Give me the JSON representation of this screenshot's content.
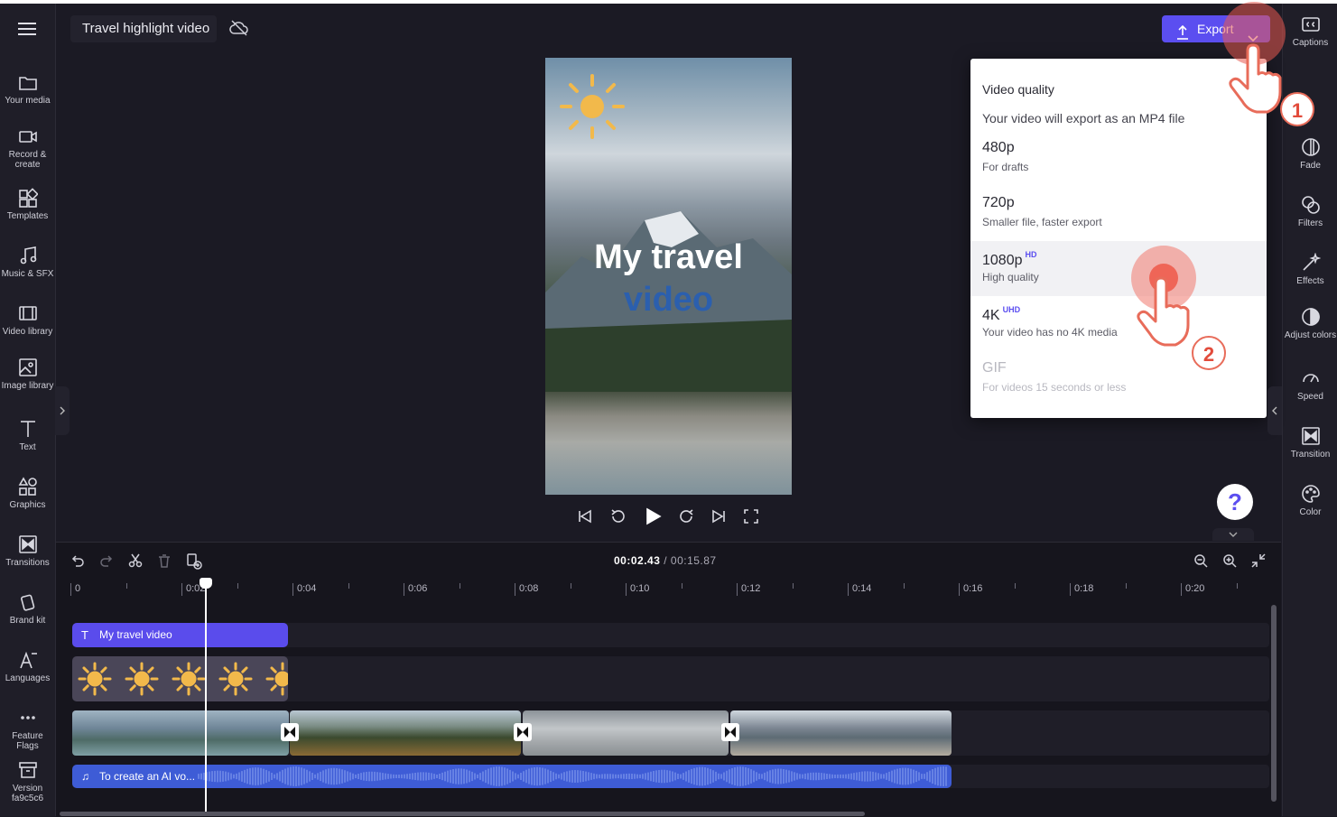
{
  "project": {
    "title": "Travel highlight video"
  },
  "header": {
    "export_label": "Export"
  },
  "left_nav": [
    {
      "label": "Your media",
      "icon": "folder-icon"
    },
    {
      "label": "Record & create",
      "icon": "camera-icon"
    },
    {
      "label": "Templates",
      "icon": "templates-icon"
    },
    {
      "label": "Music & SFX",
      "icon": "music-icon"
    },
    {
      "label": "Video library",
      "icon": "film-icon"
    },
    {
      "label": "Image library",
      "icon": "image-icon"
    },
    {
      "label": "Text",
      "icon": "text-icon"
    },
    {
      "label": "Graphics",
      "icon": "shapes-icon"
    },
    {
      "label": "Transitions",
      "icon": "transition-icon"
    },
    {
      "label": "Brand kit",
      "icon": "brand-kit-icon"
    },
    {
      "label": "Languages",
      "icon": "languages-icon"
    },
    {
      "label": "Feature Flags",
      "icon": "more-icon"
    },
    {
      "label": "Version fa9c5c6",
      "icon": "archive-icon"
    }
  ],
  "right_nav": [
    {
      "label": "Captions",
      "icon": "captions-icon"
    },
    {
      "label": "Fade",
      "icon": "fade-icon"
    },
    {
      "label": "Filters",
      "icon": "filters-icon"
    },
    {
      "label": "Effects",
      "icon": "effects-icon"
    },
    {
      "label": "Adjust colors",
      "icon": "adjust-colors-icon"
    },
    {
      "label": "Speed",
      "icon": "speed-icon"
    },
    {
      "label": "Transition",
      "icon": "transition-icon"
    },
    {
      "label": "Color",
      "icon": "palette-icon"
    }
  ],
  "preview": {
    "title_line1": "My travel",
    "title_line2": "video"
  },
  "export_menu": {
    "heading": "Video quality",
    "subheading": "Your video will export as an MP4 file",
    "options": [
      {
        "title": "480p",
        "badge": "",
        "subtitle": "For drafts",
        "disabled": false
      },
      {
        "title": "720p",
        "badge": "",
        "subtitle": "Smaller file, faster export",
        "disabled": false
      },
      {
        "title": "1080p",
        "badge": "HD",
        "subtitle": "High quality",
        "disabled": false
      },
      {
        "title": "4K",
        "badge": "UHD",
        "subtitle": "Your video has no 4K media",
        "disabled": false
      },
      {
        "title": "GIF",
        "badge": "",
        "subtitle": "For videos 15 seconds or less",
        "disabled": true
      }
    ]
  },
  "help": {
    "label": "?"
  },
  "timeline": {
    "current_time": "00:02.43",
    "separator": " / ",
    "total_time": "00:15.87",
    "ruler": [
      "0",
      "0:02",
      "0:04",
      "0:06",
      "0:08",
      "0:10",
      "0:12",
      "0:14",
      "0:16",
      "0:18",
      "0:20"
    ],
    "text_clip_label": "My travel video",
    "audio_clip_label": "To create an AI vo..."
  },
  "annotations": {
    "step1": "1",
    "step2": "2"
  },
  "colors": {
    "accent": "#5b4ef0",
    "background": "#1b1a24",
    "audio": "#3e5cd6",
    "callout": "#e86c5a"
  }
}
